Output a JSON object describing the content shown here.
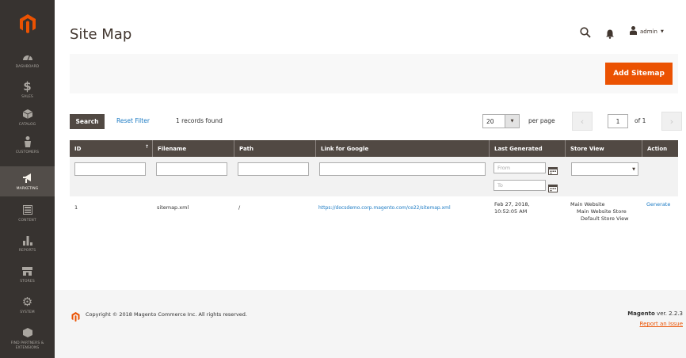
{
  "sidebar": {
    "items": [
      {
        "label": "Dashboard",
        "icon": "dashboard-icon"
      },
      {
        "label": "Sales",
        "icon": "dollar-icon"
      },
      {
        "label": "Catalog",
        "icon": "catalog-cube-icon"
      },
      {
        "label": "Customers",
        "icon": "customer-icon"
      },
      {
        "label": "Marketing",
        "icon": "megaphone-icon"
      },
      {
        "label": "Content",
        "icon": "content-layout-icon"
      },
      {
        "label": "Reports",
        "icon": "bar-chart-icon"
      },
      {
        "label": "Stores",
        "icon": "store-icon"
      },
      {
        "label": "System",
        "icon": "gear-icon"
      },
      {
        "label": "Find Partners & Extensions",
        "icon": "partners-cube-icon"
      }
    ]
  },
  "header": {
    "title": "Site Map",
    "admin_label": "admin"
  },
  "actions": {
    "add_label": "Add Sitemap"
  },
  "grid": {
    "search_label": "Search",
    "reset_label": "Reset Filter",
    "records": "1 records found",
    "per_page_value": "20",
    "per_page_label": "per page",
    "page": "1",
    "of_label": "of 1",
    "columns": [
      "ID",
      "Filename",
      "Path",
      "Link for Google",
      "Last Generated",
      "Store View",
      "Action"
    ],
    "date_from": "From",
    "date_to": "To",
    "rows": [
      {
        "id": "1",
        "filename": "sitemap.xml",
        "path": "/",
        "link": "https://docsdemo.corp.magento.com/ce22/sitemap.xml",
        "generated_date": "Feb 27, 2018,",
        "generated_time": "10:52:05 AM",
        "store_website": "Main Website",
        "store_name": "Main Website Store",
        "store_view": "Default Store View",
        "action": "Generate"
      }
    ]
  },
  "footer": {
    "copyright": "Copyright © 2018 Magento Commerce Inc. All rights reserved.",
    "brand": "Magento",
    "version": "ver. 2.2.3",
    "report": "Report an Issue"
  },
  "colors": {
    "accent": "#eb5202",
    "sidebar": "#373330",
    "header_row": "#514943",
    "link": "#1979c3"
  }
}
